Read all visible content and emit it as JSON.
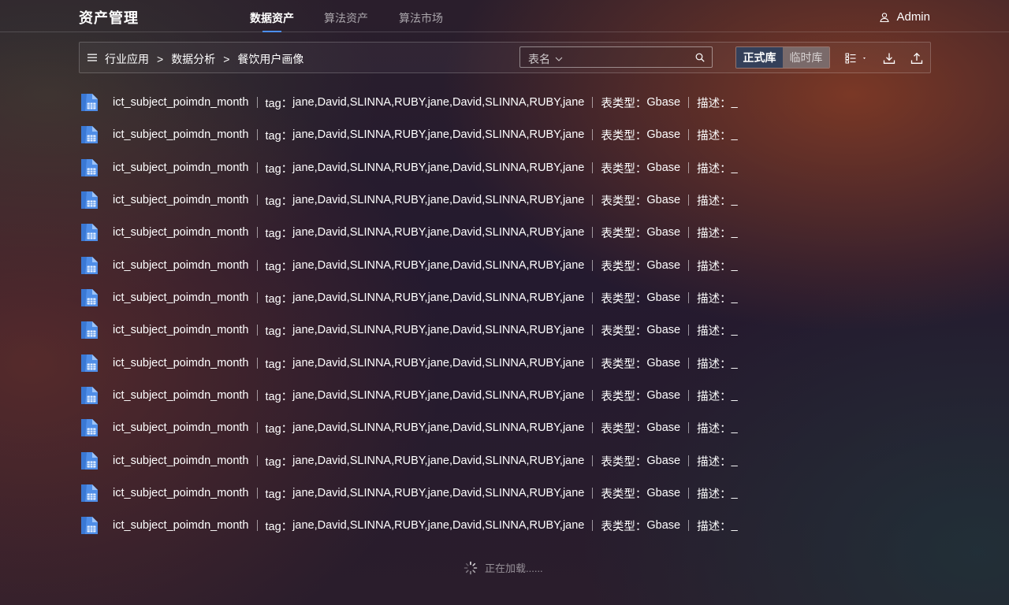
{
  "header": {
    "app_title": "资产管理",
    "tabs": [
      {
        "label": "数据资产",
        "active": true
      },
      {
        "label": "算法资产",
        "active": false
      },
      {
        "label": "算法市场",
        "active": false
      }
    ],
    "user": {
      "name": "Admin",
      "icon": "user-icon"
    },
    "accent_color": "#4c8ff5"
  },
  "toolbar": {
    "menu_icon": "hamburger-menu-icon",
    "breadcrumb": [
      "行业应用",
      "数据分析",
      "餐饮用户画像"
    ],
    "breadcrumb_separator": ">",
    "search": {
      "filter_value": "表名",
      "value": "",
      "placeholder": ""
    },
    "library_toggle": {
      "options": [
        "正式库",
        "临时库"
      ],
      "selected": "正式库"
    },
    "icons": [
      "view-mode-icon",
      "download-icon",
      "upload-icon"
    ]
  },
  "list": {
    "item_icon": "table-file-icon",
    "tag_label": "tag：",
    "type_label": "表类型：",
    "desc_label": "描述：",
    "items": [
      {
        "name": "ict_subject_poimdn_month",
        "tags": "jane,David,SLINNA,RUBY,jane,David,SLINNA,RUBY,jane",
        "table_type": "Gbase",
        "description": "_"
      },
      {
        "name": "ict_subject_poimdn_month",
        "tags": "jane,David,SLINNA,RUBY,jane,David,SLINNA,RUBY,jane",
        "table_type": "Gbase",
        "description": "_"
      },
      {
        "name": "ict_subject_poimdn_month",
        "tags": "jane,David,SLINNA,RUBY,jane,David,SLINNA,RUBY,jane",
        "table_type": "Gbase",
        "description": "_"
      },
      {
        "name": "ict_subject_poimdn_month",
        "tags": "jane,David,SLINNA,RUBY,jane,David,SLINNA,RUBY,jane",
        "table_type": "Gbase",
        "description": "_"
      },
      {
        "name": "ict_subject_poimdn_month",
        "tags": "jane,David,SLINNA,RUBY,jane,David,SLINNA,RUBY,jane",
        "table_type": "Gbase",
        "description": "_"
      },
      {
        "name": "ict_subject_poimdn_month",
        "tags": "jane,David,SLINNA,RUBY,jane,David,SLINNA,RUBY,jane",
        "table_type": "Gbase",
        "description": "_"
      },
      {
        "name": "ict_subject_poimdn_month",
        "tags": "jane,David,SLINNA,RUBY,jane,David,SLINNA,RUBY,jane",
        "table_type": "Gbase",
        "description": "_"
      },
      {
        "name": "ict_subject_poimdn_month",
        "tags": "jane,David,SLINNA,RUBY,jane,David,SLINNA,RUBY,jane",
        "table_type": "Gbase",
        "description": "_"
      },
      {
        "name": "ict_subject_poimdn_month",
        "tags": "jane,David,SLINNA,RUBY,jane,David,SLINNA,RUBY,jane",
        "table_type": "Gbase",
        "description": "_"
      },
      {
        "name": "ict_subject_poimdn_month",
        "tags": "jane,David,SLINNA,RUBY,jane,David,SLINNA,RUBY,jane",
        "table_type": "Gbase",
        "description": "_"
      },
      {
        "name": "ict_subject_poimdn_month",
        "tags": "jane,David,SLINNA,RUBY,jane,David,SLINNA,RUBY,jane",
        "table_type": "Gbase",
        "description": "_"
      },
      {
        "name": "ict_subject_poimdn_month",
        "tags": "jane,David,SLINNA,RUBY,jane,David,SLINNA,RUBY,jane",
        "table_type": "Gbase",
        "description": "_"
      },
      {
        "name": "ict_subject_poimdn_month",
        "tags": "jane,David,SLINNA,RUBY,jane,David,SLINNA,RUBY,jane",
        "table_type": "Gbase",
        "description": "_"
      },
      {
        "name": "ict_subject_poimdn_month",
        "tags": "jane,David,SLINNA,RUBY,jane,David,SLINNA,RUBY,jane",
        "table_type": "Gbase",
        "description": "_"
      }
    ]
  },
  "loading": {
    "text": "正在加载......",
    "icon": "loading-spinner-icon"
  }
}
